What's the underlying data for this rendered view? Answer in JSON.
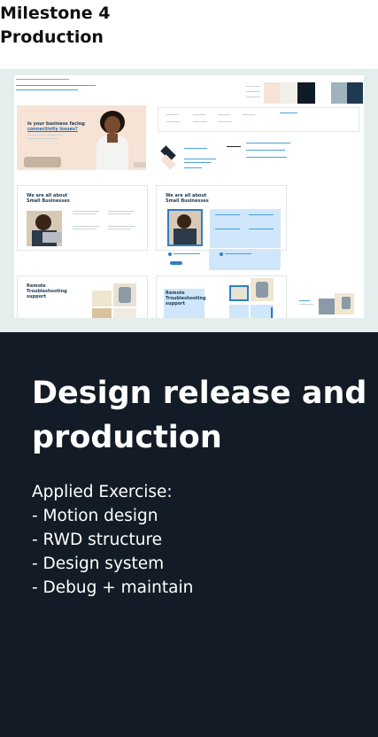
{
  "header": {
    "milestone": "Milestone 4",
    "stage": "Production"
  },
  "preview": {
    "alt": "Design system board screenshot",
    "hero_heading_line1": "Is your business facing",
    "hero_heading_line2": "connectivity issues?",
    "card_heading_1": "We are all about",
    "card_heading_2": "Small Businesses",
    "card_heading_3": "Remote",
    "card_heading_4": "Troubleshooting",
    "card_heading_5": "support",
    "swatch_colors": [
      "#f6e3d6",
      "#f1efe9",
      "#0f1b26",
      "#1e3a53",
      "#9fb3bf",
      "#2a3f54"
    ]
  },
  "section": {
    "title": "Design release and production",
    "exercise_label": "Applied Exercise:",
    "exercise_items": [
      "- Motion design",
      "- RWD structure",
      "- Design system",
      "- Debug + maintain"
    ]
  },
  "colors": {
    "dark_bg": "#131c26",
    "preview_bg": "#e4eeec",
    "accent_blue": "#4aa3d8"
  }
}
